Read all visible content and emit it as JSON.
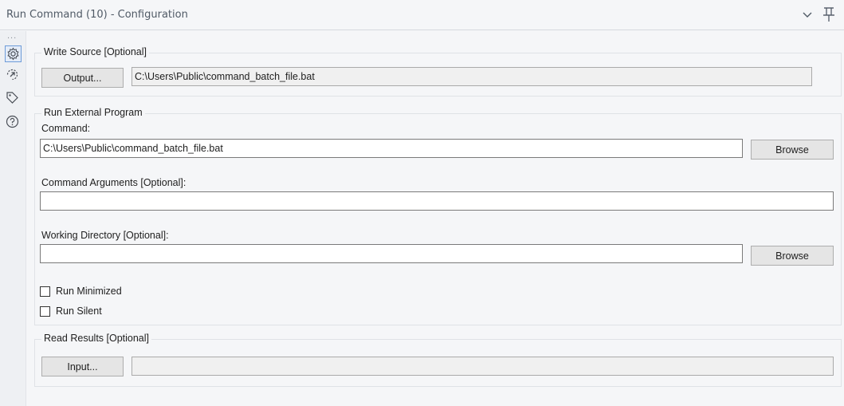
{
  "window": {
    "title": "Run Command (10) - Configuration",
    "chevron_icon": "chevron-down-icon",
    "pin_icon": "pin-icon"
  },
  "sidebar": {
    "dots": "...",
    "items": [
      {
        "icon": "gear-icon",
        "active": true
      },
      {
        "icon": "connection-arrow-icon",
        "active": false
      },
      {
        "icon": "tag-icon",
        "active": false
      },
      {
        "icon": "help-icon",
        "active": false
      }
    ]
  },
  "write_source": {
    "legend": "Write Source [Optional]",
    "button_label": "Output...",
    "path_value": "C:\\Users\\Public\\command_batch_file.bat"
  },
  "run_external": {
    "legend": "Run External Program",
    "command_label": "Command:",
    "command_value": "C:\\Users\\Public\\command_batch_file.bat",
    "browse_label": "Browse",
    "args_label": "Command Arguments [Optional]:",
    "args_value": "",
    "workdir_label": "Working Directory [Optional]:",
    "workdir_value": "",
    "browse2_label": "Browse",
    "run_minimized_label": "Run Minimized",
    "run_minimized_checked": false,
    "run_silent_label": "Run Silent",
    "run_silent_checked": false
  },
  "read_results": {
    "legend": "Read Results [Optional]",
    "button_label": "Input...",
    "path_value": ""
  }
}
